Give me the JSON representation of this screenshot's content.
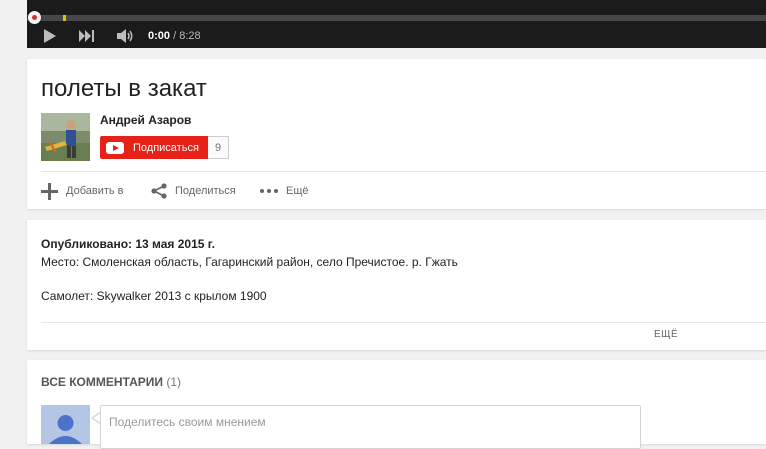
{
  "player": {
    "current_time": "0:00",
    "total_time": "/ 8:28",
    "progress": 0
  },
  "video": {
    "title": "полеты в закат"
  },
  "channel": {
    "name": "Андрей Азаров",
    "subscribe_label": "Подписаться",
    "subscriber_count": "9"
  },
  "actions": {
    "add_label": "Добавить в",
    "share_label": "Поделиться",
    "more_label": "Ещё"
  },
  "description": {
    "published": "Опубликовано: 13 мая 2015 г.",
    "line1": "Место: Смоленская область, Гагаринский район, село Пречистое. р. Гжать",
    "line2": "Самолет: Skywalker 2013 с крылом 1900",
    "more_label": "ЕЩЁ"
  },
  "comments": {
    "title": "ВСЕ КОММЕНТАРИИ",
    "count": "(1)",
    "placeholder": "Поделитесь своим мнением"
  },
  "colors": {
    "accent": "#e62117",
    "player_bg": "#1b1b1b",
    "buffer": "#e6c200",
    "avatar_placeholder": "#b4c6e4"
  },
  "icons": {
    "play": "play-icon",
    "next": "next-icon",
    "volume": "volume-icon",
    "add": "plus-icon",
    "share": "share-icon",
    "more": "more-dots-icon",
    "subscribe": "youtube-logo-icon"
  }
}
